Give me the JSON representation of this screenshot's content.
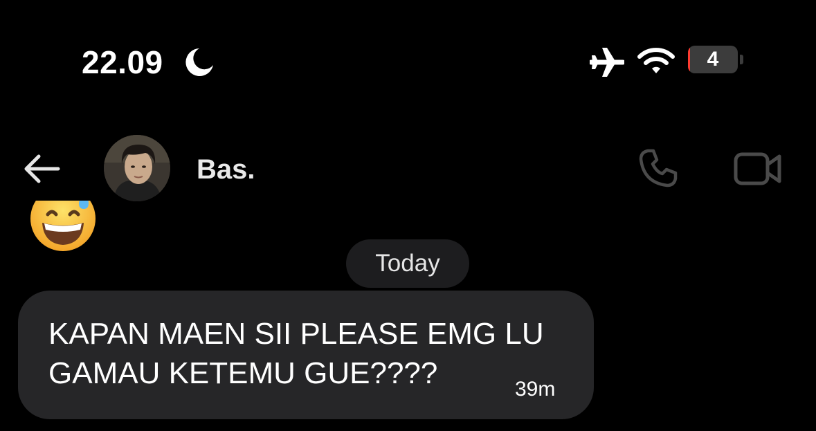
{
  "status_bar": {
    "time": "22.09",
    "focus_icon": "moon-icon",
    "airplane_icon": "airplane-icon",
    "wifi_icon": "wifi-icon",
    "battery_level_text": "4",
    "battery_percent": 4,
    "battery_color": "#ff3b30"
  },
  "header": {
    "back_icon": "arrow-left-icon",
    "contact_name": "Bas.",
    "call_icon": "phone-icon",
    "video_icon": "video-camera-icon"
  },
  "conversation": {
    "previous_message_emoji": "grinning-face-with-sweat",
    "date_separator": "Today",
    "messages": [
      {
        "text": "KAPAN MAEN SII PLEASE EMG LU GAMAU KETEMU GUE????",
        "time": "39m"
      }
    ]
  },
  "colors": {
    "background": "#000000",
    "bubble": "#262628",
    "pill": "#1d1d1f",
    "icon_gray": "#4a4a4a"
  }
}
